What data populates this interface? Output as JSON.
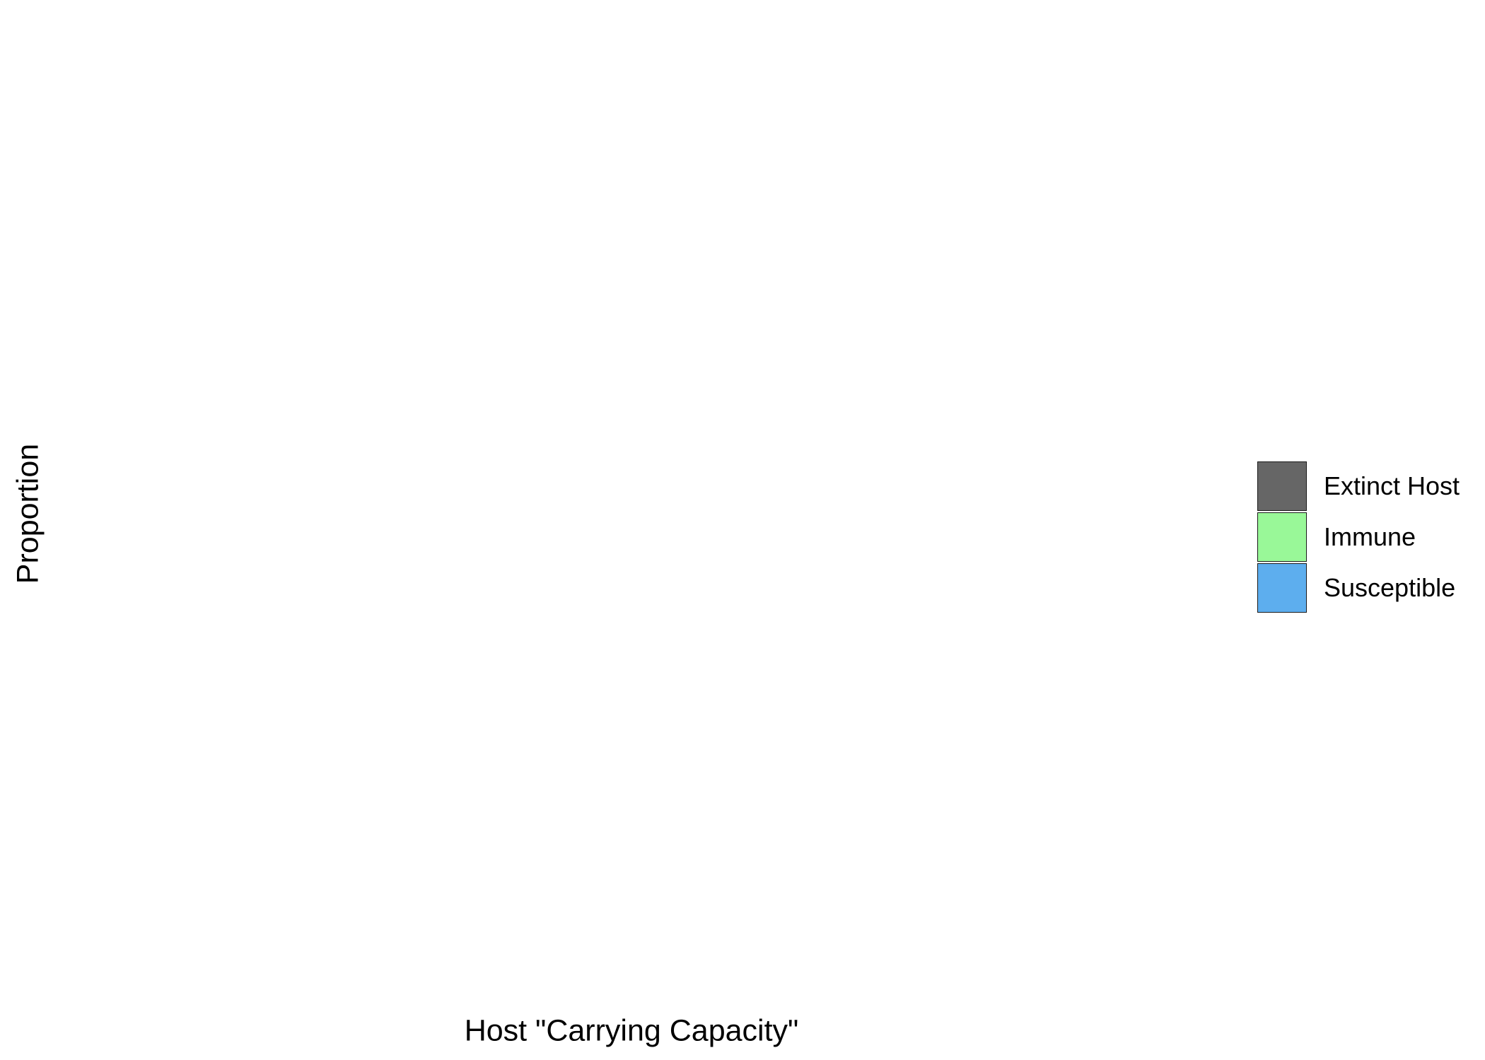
{
  "chart_data": {
    "type": "area",
    "title": "",
    "xlabel": "Host \"Carrying Capacity\"",
    "ylabel": "Proportion",
    "grid": false,
    "legend_position": "right",
    "series": [
      {
        "name": "Extinct Host",
        "color": "#666666",
        "values": []
      },
      {
        "name": "Immune",
        "color": "#99f898",
        "values": []
      },
      {
        "name": "Susceptible",
        "color": "#5daeee",
        "values": []
      }
    ]
  }
}
